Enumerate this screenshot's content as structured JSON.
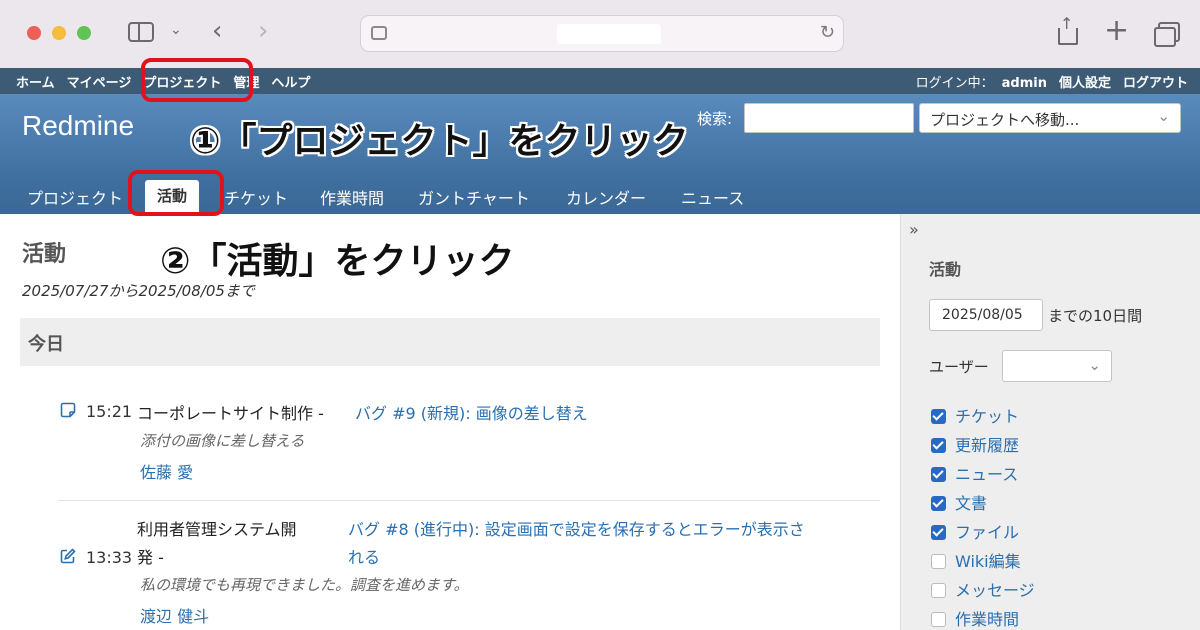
{
  "topmenu": {
    "left": [
      "ホーム",
      "マイページ",
      "プロジェクト",
      "管理",
      "ヘルプ"
    ],
    "logged_in_label": "ログイン中：",
    "user": "admin",
    "my_account": "個人設定",
    "logout": "ログアウト"
  },
  "header": {
    "brand": "Redmine",
    "search_label": "検索:",
    "jump_placeholder": "プロジェクトへ移動..."
  },
  "mainmenu": [
    "プロジェクト",
    "活動",
    "チケット",
    "作業時間",
    "ガントチャート",
    "カレンダー",
    "ニュース"
  ],
  "annotations": {
    "step1": "①「プロジェクト」をクリック",
    "step2": "②「活動」をクリック",
    "color": "#e0131c"
  },
  "content": {
    "title": "活動",
    "range": "2025/07/27から2025/08/05まで",
    "day": "今日",
    "entries": [
      {
        "icon": "ticket-note-icon",
        "time": "15:21",
        "project": "コーポレートサイト制作 -",
        "link": "バグ #9 (新規): 画像の差し替え",
        "desc": "添付の画像に差し替える",
        "author": "佐藤 愛"
      },
      {
        "icon": "ticket-edit-icon",
        "time": "13:33",
        "project_line1": "利用者管理システム開",
        "project_line2": "発 -",
        "link_line1": "バグ #8 (進行中): 設定画面で設定を保存するとエラーが表示さ",
        "link_line2": "れる",
        "desc": "私の環境でも再現できました。調査を進めます。",
        "author": "渡辺 健斗"
      }
    ]
  },
  "sidebar": {
    "toggle": "»",
    "title": "活動",
    "date": "2025/08/05",
    "date_suffix": "までの10日間",
    "user_label": "ユーザー",
    "filters": [
      {
        "label": "チケット",
        "checked": true
      },
      {
        "label": "更新履歴",
        "checked": true
      },
      {
        "label": "ニュース",
        "checked": true
      },
      {
        "label": "文書",
        "checked": true
      },
      {
        "label": "ファイル",
        "checked": true
      },
      {
        "label": "Wiki編集",
        "checked": false
      },
      {
        "label": "メッセージ",
        "checked": false
      },
      {
        "label": "作業時間",
        "checked": false
      }
    ]
  },
  "colors": {
    "topmenu_bg": "#3e5b76",
    "header_bg": "#4d7fb0",
    "link": "#2a6fb0",
    "checkbox": "#2769c4"
  }
}
